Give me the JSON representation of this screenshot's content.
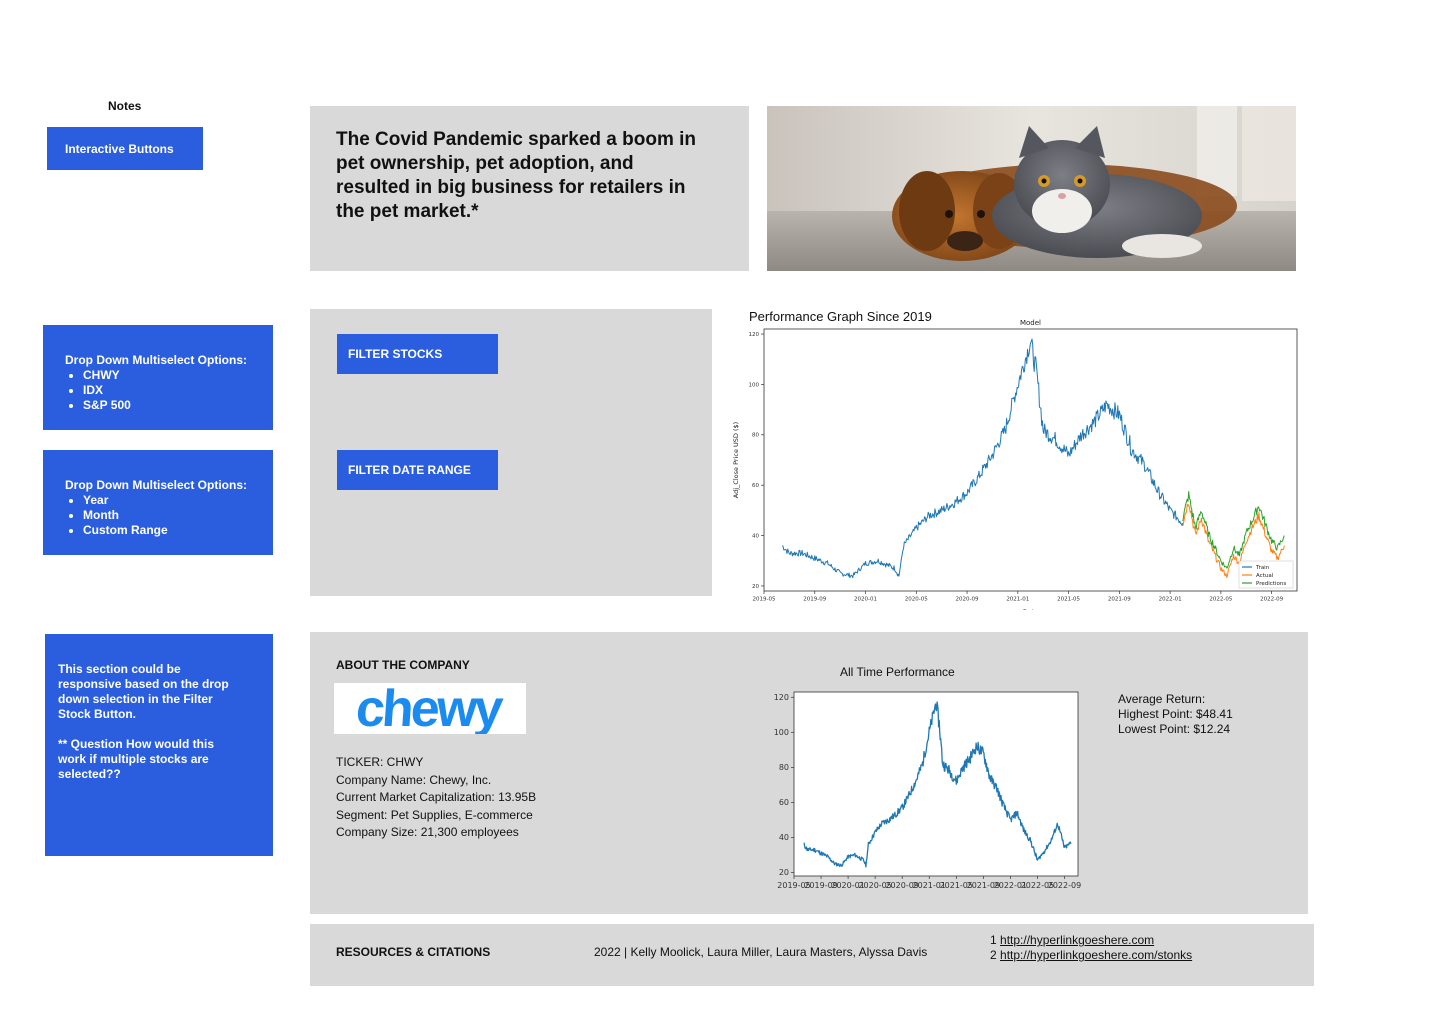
{
  "notes": {
    "title": "Notes",
    "interactive_label": "Interactive Buttons",
    "dropdown1": {
      "heading": "Drop Down Multiselect Options:",
      "items": [
        "CHWY",
        "IDX",
        "S&P 500"
      ]
    },
    "dropdown2": {
      "heading": "Drop Down Multiselect Options:",
      "items": [
        "Year",
        "Month",
        "Custom Range"
      ]
    },
    "responsive_note": [
      "This section could be",
      "responsive based on the drop",
      "down selection in the Filter",
      "Stock Button.",
      "",
      "** Question How would this",
      "work if multiple stocks are",
      "selected??"
    ]
  },
  "hero": {
    "text": [
      "The Covid Pandemic sparked a boom in",
      "pet ownership, pet adoption, and",
      "resulted in big business for retailers in",
      "the pet market.*"
    ]
  },
  "filters": {
    "stocks_label": "FILTER STOCKS",
    "date_label": "FILTER DATE RANGE"
  },
  "performance": {
    "title": "Performance Graph Since 2019"
  },
  "about": {
    "title": "ABOUT THE COMPANY",
    "logo_text": "chewy",
    "info": [
      "TICKER: CHWY",
      "Company Name: Chewy, Inc.",
      "Current Market Capitalization: 13.95B",
      "Segment: Pet Supplies, E-commerce",
      "Company Size: 21,300 employees"
    ],
    "stats": [
      "Average Return:",
      "Highest Point: $48.41",
      "Lowest Point: $12.24"
    ]
  },
  "resources": {
    "title": "RESOURCES & CITATIONS",
    "credits": "2022 | Kelly Moolick, Laura Miller, Laura Masters, Alyssa Davis",
    "links": [
      {
        "num": "1",
        "url": "http://hyperlinkgoeshere.com"
      },
      {
        "num": "2",
        "url": "http://hyperlinkgoeshere.com/stonks"
      }
    ]
  },
  "colors": {
    "accent_blue": "#2a5ede",
    "panel_gray": "#d9d9d9",
    "line_blue": "#1f77b4",
    "line_orange": "#ff7f0e",
    "line_green": "#2ca02c",
    "chewy_blue": "#1c8bef"
  },
  "chart_data": [
    {
      "type": "line",
      "title": "Model",
      "xlabel": "Date",
      "ylabel": "Adj_Close Price USD ($)",
      "ylim": [
        18,
        122
      ],
      "xlim": [
        "2019-05",
        "2022-11"
      ],
      "x_ticks": [
        "2019-05",
        "2019-09",
        "2020-01",
        "2020-05",
        "2020-09",
        "2021-01",
        "2021-05",
        "2021-09",
        "2022-01",
        "2022-05",
        "2022-09"
      ],
      "y_ticks": [
        20,
        40,
        60,
        80,
        100,
        120
      ],
      "legend": "bottom-right",
      "grid": false,
      "series": [
        {
          "name": "Train",
          "x": [
            "2019-06-14",
            "2019-07",
            "2019-08",
            "2019-09",
            "2019-10",
            "2019-11",
            "2019-12",
            "2020-01",
            "2020-02",
            "2020-03-10",
            "2020-03-20",
            "2020-04",
            "2020-05",
            "2020-06",
            "2020-07",
            "2020-08",
            "2020-09",
            "2020-10",
            "2020-11",
            "2020-12",
            "2021-01",
            "2021-02-01",
            "2021-02-15",
            "2021-03",
            "2021-04",
            "2021-05",
            "2021-06",
            "2021-07",
            "2021-08",
            "2021-09",
            "2021-10",
            "2021-11",
            "2021-12",
            "2022-01",
            "2022-02-01"
          ],
          "values": [
            36,
            33,
            33,
            31,
            29,
            25,
            24,
            29,
            30,
            27,
            24,
            36,
            43,
            48,
            50,
            53,
            57,
            64,
            72,
            82,
            100,
            117,
            105,
            82,
            78,
            72,
            80,
            85,
            92,
            88,
            74,
            68,
            58,
            50,
            45
          ]
        },
        {
          "name": "Actual",
          "x": [
            "2022-02-01",
            "2022-02-15",
            "2022-03",
            "2022-03-15",
            "2022-04",
            "2022-04-15",
            "2022-05",
            "2022-05-15",
            "2022-06",
            "2022-06-15",
            "2022-07",
            "2022-07-15",
            "2022-08",
            "2022-08-15",
            "2022-09",
            "2022-09-15",
            "2022-10"
          ],
          "values": [
            45,
            54,
            40,
            47,
            38,
            33,
            27,
            24,
            32,
            29,
            38,
            43,
            48,
            41,
            34,
            31,
            36
          ]
        },
        {
          "name": "Predictions",
          "x": [
            "2022-02-01",
            "2022-02-15",
            "2022-03",
            "2022-03-15",
            "2022-04",
            "2022-04-15",
            "2022-05",
            "2022-05-15",
            "2022-06",
            "2022-06-15",
            "2022-07",
            "2022-07-15",
            "2022-08",
            "2022-08-15",
            "2022-09",
            "2022-09-15",
            "2022-10"
          ],
          "values": [
            47,
            56,
            43,
            50,
            41,
            36,
            30,
            27,
            35,
            32,
            41,
            46,
            52,
            45,
            38,
            35,
            40
          ]
        }
      ]
    },
    {
      "type": "line",
      "title": "All Time Performance",
      "xlabel": "",
      "ylabel": "",
      "ylim": [
        18,
        123
      ],
      "xlim": [
        "2019-05",
        "2022-11"
      ],
      "x_ticks": [
        "2019-05",
        "2019-09",
        "2020-01",
        "2020-05",
        "2020-09",
        "2021-01",
        "2021-05",
        "2021-09",
        "2022-01",
        "2022-05",
        "2022-09"
      ],
      "y_ticks": [
        20,
        40,
        60,
        80,
        100,
        120
      ],
      "grid": false,
      "series": [
        {
          "x": [
            "2019-06-14",
            "2019-07",
            "2019-08",
            "2019-09",
            "2019-10",
            "2019-11",
            "2019-12",
            "2020-01",
            "2020-02",
            "2020-03-10",
            "2020-03-20",
            "2020-04",
            "2020-05",
            "2020-06",
            "2020-07",
            "2020-08",
            "2020-09",
            "2020-10",
            "2020-11",
            "2020-12",
            "2021-01",
            "2021-02-01",
            "2021-02-15",
            "2021-03",
            "2021-04",
            "2021-05",
            "2021-06",
            "2021-07",
            "2021-08",
            "2021-09",
            "2021-10",
            "2021-11",
            "2021-12",
            "2022-01",
            "2022-02",
            "2022-03",
            "2022-04",
            "2022-05",
            "2022-06",
            "2022-07",
            "2022-08",
            "2022-09",
            "2022-10"
          ],
          "values": [
            36,
            33,
            33,
            31,
            29,
            25,
            24,
            29,
            30,
            27,
            24,
            36,
            43,
            48,
            50,
            53,
            57,
            64,
            72,
            82,
            100,
            117,
            105,
            82,
            78,
            72,
            80,
            85,
            92,
            88,
            74,
            68,
            58,
            50,
            54,
            44,
            38,
            27,
            32,
            38,
            48,
            34,
            37
          ]
        }
      ]
    }
  ]
}
